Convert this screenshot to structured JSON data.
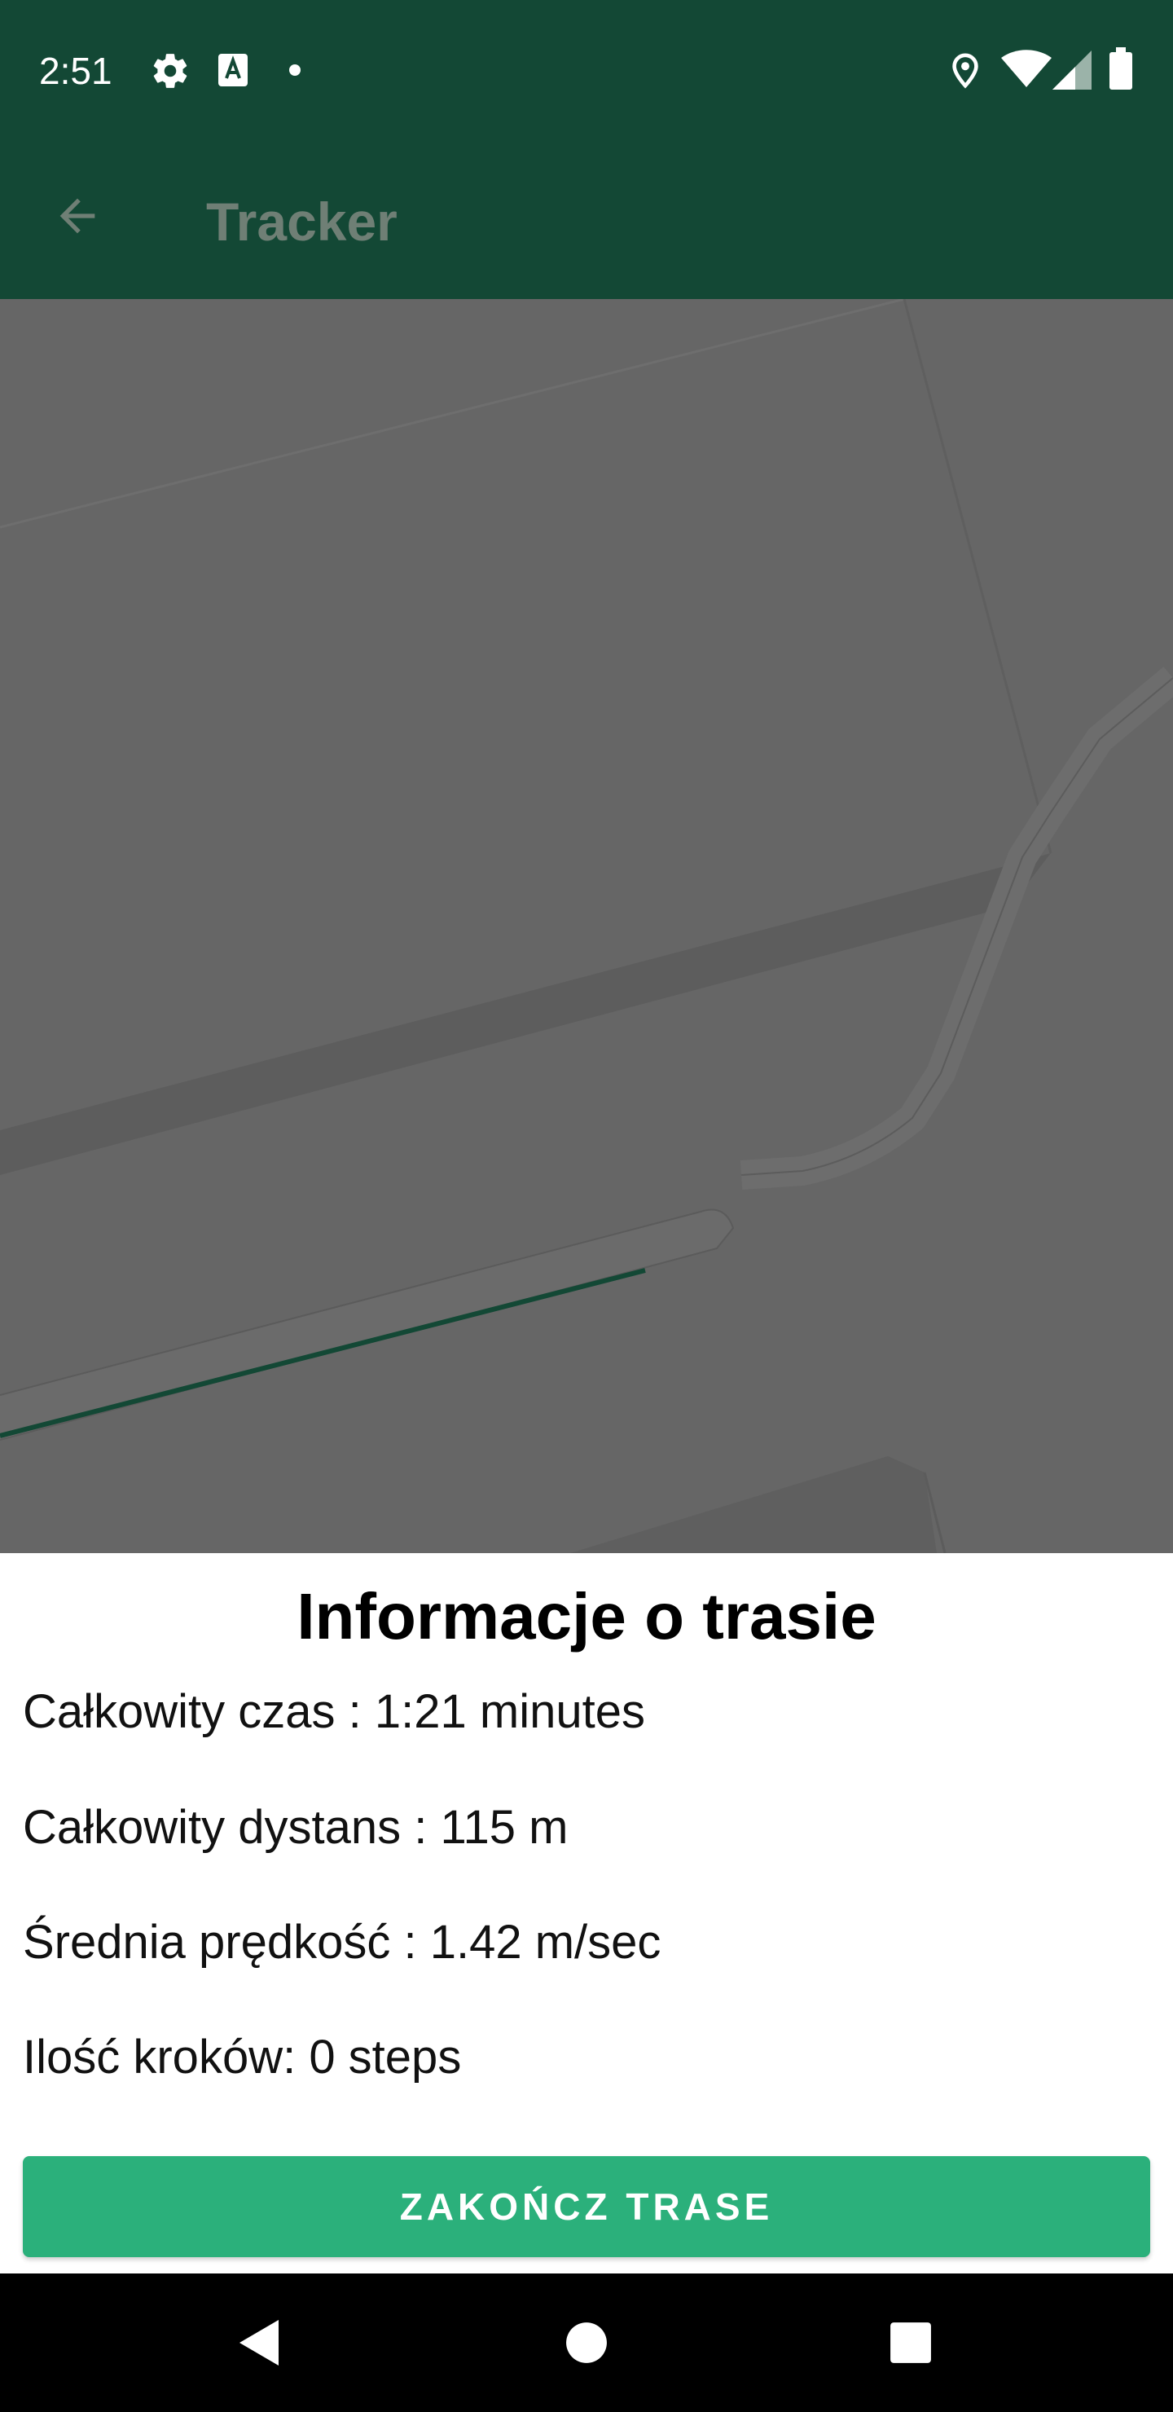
{
  "status_bar": {
    "time": "2:51",
    "icons": [
      "settings-icon",
      "text-a-icon",
      "dot-icon",
      "location-icon",
      "wifi-icon",
      "signal-icon",
      "battery-icon"
    ]
  },
  "app_bar": {
    "title": "Tracker",
    "back_icon": "arrow-left-icon",
    "background": "#134835"
  },
  "map": {
    "background": "#666666",
    "route_color": "#134835"
  },
  "route_info": {
    "title": "Informacje o trasie",
    "total_time": "Całkowity czas : 1:21 minutes",
    "total_distance": "Całkowity dystans : 115 m",
    "avg_speed": "Średnia prędkość : 1.42 m/sec",
    "steps": "Ilość kroków: 0 steps"
  },
  "finish_button": {
    "label": "ZAKOŃCZ TRASE",
    "color": "#2bb07b"
  },
  "nav_bar": {
    "icons": [
      "back-triangle-icon",
      "home-circle-icon",
      "recents-square-icon"
    ]
  }
}
